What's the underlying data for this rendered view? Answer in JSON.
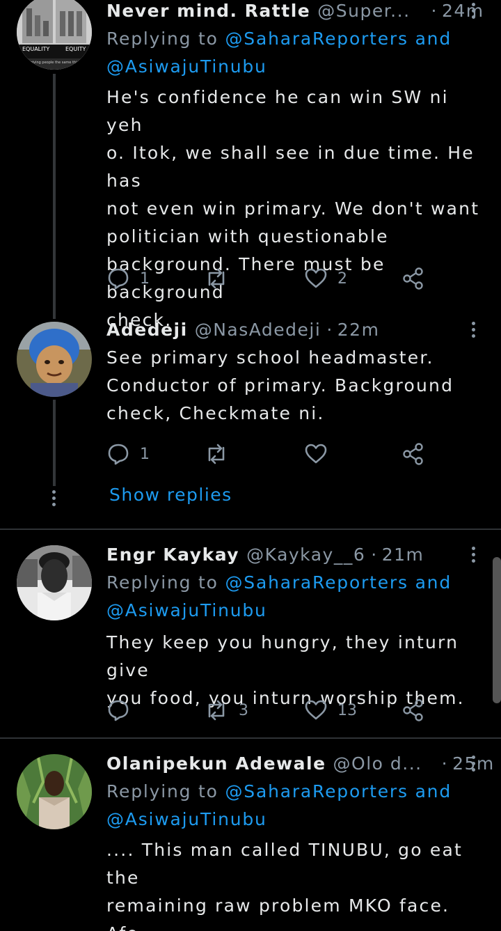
{
  "tweets": [
    {
      "name": "Never mind. Rattle",
      "handle": "@Super...",
      "dot": "·",
      "time": "24m",
      "replying_prefix": "Replying to",
      "replying_mention1": "@SaharaReporters",
      "replying_and": "and",
      "replying_mention2": "@AsiwajuTinubu",
      "avatar_caption_left": "EQUALITY",
      "avatar_caption_right": "EQUITY",
      "avatar_caption_small": "is giving people the same thing",
      "text": "He's confidence he can win SW ni yeh\no. Itok, we shall see in due time. He has\nnot even win primary. We don't want\npolitician with questionable\nbackground. There must be background\ncheck.",
      "replies": "1",
      "retweets": "",
      "likes": "2"
    },
    {
      "name": "Adedeji",
      "handle": "@NasAdedeji",
      "dot": "·",
      "time": "22m",
      "text": "See primary school headmaster.\nConductor of primary. Background\ncheck, Checkmate ni.",
      "replies": "1",
      "retweets": "",
      "likes": ""
    },
    {
      "name": "Engr Kaykay",
      "handle": "@Kaykay__6",
      "dot": "·",
      "time": "21m",
      "replying_prefix": "Replying to",
      "replying_mention1": "@SaharaReporters",
      "replying_and": "and",
      "replying_mention2": "@AsiwajuTinubu",
      "text": "They keep you hungry, they inturn give\nyou food, you inturn worship them.",
      "replies": "",
      "retweets": "3",
      "likes": "13"
    },
    {
      "name": "Olanipekun Adewale",
      "handle": "@Olo d...",
      "dot": "·",
      "time": "25m",
      "replying_prefix": "Replying to",
      "replying_mention1": "@SaharaReporters",
      "replying_and": "and",
      "replying_mention2": "@AsiwajuTinubu",
      "text": ".... This man called TINUBU, go eat the\nremaining raw problem MKO face. Afo\n'ta igba, mafo inu igba"
    }
  ],
  "show_replies": "Show replies",
  "icons": {
    "reply": "reply-icon",
    "retweet": "retweet-icon",
    "like": "heart-icon",
    "share": "share-icon",
    "more": "more-vertical-icon"
  },
  "colors": {
    "background": "#000000",
    "text": "#e7e9ea",
    "secondary": "#8b98a5",
    "accent": "#1d9bf0",
    "divider": "#2f3336"
  }
}
